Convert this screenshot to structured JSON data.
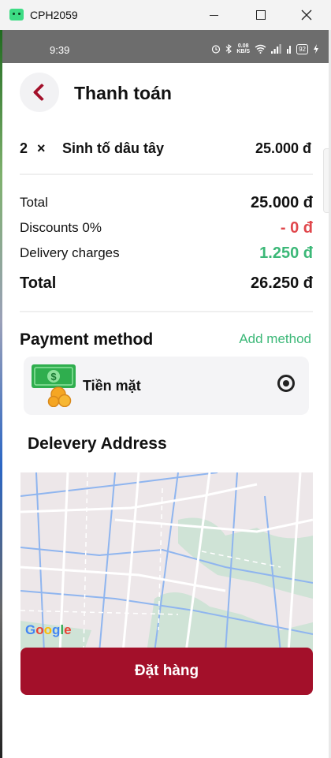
{
  "window": {
    "title": "CPH2059"
  },
  "status_bar": {
    "time": "9:39",
    "speed_value": "0.08",
    "speed_unit": "KB/S",
    "battery": "92"
  },
  "header": {
    "title": "Thanh toán"
  },
  "order_item": {
    "quantity": "2",
    "times": "×",
    "name": "Sinh tố dâu tây",
    "price": "25.000 đ"
  },
  "summary": {
    "subtotal_label": "Total",
    "subtotal_value": "25.000 đ",
    "discount_label": "Discounts 0%",
    "discount_value": "- 0 đ",
    "delivery_label": "Delivery charges",
    "delivery_value": "1.250 đ",
    "total_label": "Total",
    "total_value": "26.250 đ"
  },
  "payment": {
    "title": "Payment method",
    "add_label": "Add method",
    "method_label": "Tiền mặt",
    "method_selected": true
  },
  "address": {
    "title": "Delevery Address",
    "map_logo": "Google"
  },
  "order_button": {
    "label": "Đặt hàng"
  },
  "colors": {
    "brand": "#a3102a",
    "green": "#3cb878",
    "discount_red": "#e0474c",
    "status_bar": "#6d6d6d"
  },
  "icons": {
    "back": "chevron-left-icon",
    "cash": "cash-money-icon",
    "radio": "radio-selected-icon"
  }
}
